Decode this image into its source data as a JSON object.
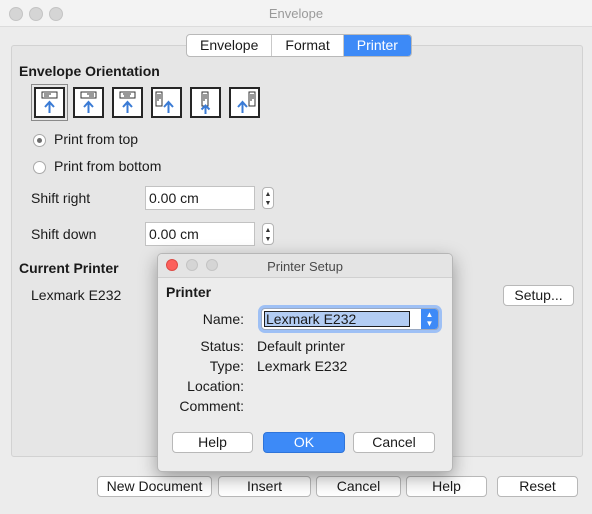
{
  "window": {
    "title": "Envelope"
  },
  "tabs": [
    {
      "label": "Envelope",
      "active": false
    },
    {
      "label": "Format",
      "active": false
    },
    {
      "label": "Printer",
      "active": true
    }
  ],
  "orientation": {
    "heading": "Envelope Orientation",
    "icons": [
      "orientation-1-icon",
      "orientation-2-icon",
      "orientation-3-icon",
      "orientation-4-icon",
      "orientation-5-icon",
      "orientation-6-icon"
    ],
    "selected_index": 0
  },
  "print_from": {
    "top_label": "Print from top",
    "bottom_label": "Print from bottom",
    "selected": "top"
  },
  "shift": {
    "right_label": "Shift right",
    "right_value": "0.00 cm",
    "down_label": "Shift down",
    "down_value": "0.00 cm"
  },
  "current_printer": {
    "heading": "Current Printer",
    "name": "Lexmark E232",
    "setup_label": "Setup..."
  },
  "buttons": {
    "new_document": "New Document",
    "insert": "Insert",
    "cancel": "Cancel",
    "help": "Help",
    "reset": "Reset"
  },
  "dialog": {
    "title": "Printer Setup",
    "heading": "Printer",
    "name_label": "Name:",
    "name_value": "Lexmark E232",
    "status_label": "Status:",
    "status_value": "Default printer",
    "type_label": "Type:",
    "type_value": "Lexmark E232",
    "location_label": "Location:",
    "location_value": "",
    "comment_label": "Comment:",
    "comment_value": "",
    "help_label": "Help",
    "ok_label": "OK",
    "cancel_label": "Cancel"
  },
  "colors": {
    "accent": "#3d8af7",
    "close": "#fc605c"
  }
}
